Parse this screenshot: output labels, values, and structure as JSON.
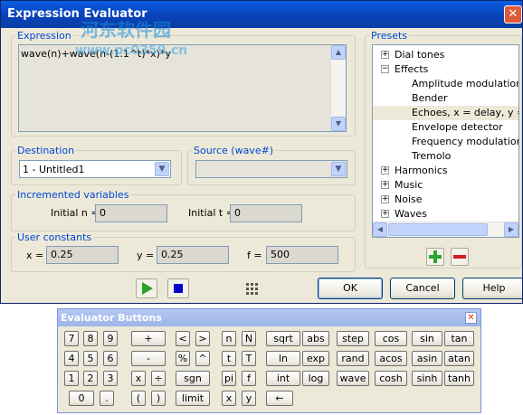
{
  "window": {
    "title": "Expression Evaluator",
    "close_glyph": "✕"
  },
  "watermark": {
    "line1": "河东软件园",
    "line2": "www.pc0359.cn"
  },
  "expression": {
    "legend": "Expression",
    "value": "wave(n)+wave(n-(1.1^t)*x)*y"
  },
  "destination": {
    "legend": "Destination",
    "selected": "1 - Untitled1"
  },
  "source": {
    "legend": "Source (wave#)",
    "selected": ""
  },
  "incremented": {
    "legend": "Incremented variables",
    "n_label": "Initial n =",
    "n_value": "0",
    "t_label": "Initial t =",
    "t_value": "0"
  },
  "constants": {
    "legend": "User constants",
    "x_label": "x =",
    "x_value": "0.25",
    "y_label": "y =",
    "y_value": "0.25",
    "f_label": "f =",
    "f_value": "500"
  },
  "presets": {
    "legend": "Presets",
    "items": [
      {
        "label": "Dial tones",
        "expander": "+"
      },
      {
        "label": "Effects",
        "expander": "−"
      },
      {
        "label": "Amplitude modulation",
        "expander": ""
      },
      {
        "label": "Bender",
        "expander": ""
      },
      {
        "label": "Echoes, x = delay, y = vo",
        "expander": ""
      },
      {
        "label": "Envelope detector",
        "expander": ""
      },
      {
        "label": "Frequency modulation",
        "expander": ""
      },
      {
        "label": "Tremolo",
        "expander": ""
      },
      {
        "label": "Harmonics",
        "expander": "+"
      },
      {
        "label": "Music",
        "expander": "+"
      },
      {
        "label": "Noise",
        "expander": "+"
      },
      {
        "label": "Waves",
        "expander": "+"
      }
    ]
  },
  "buttons": {
    "ok": "OK",
    "cancel": "Cancel",
    "help": "Help"
  },
  "colors": {
    "play": "#2ca02c",
    "stop": "#0000cc",
    "add": "#2ea52e",
    "remove": "#d02020",
    "legend": "#0046d5"
  },
  "palette": {
    "title": "Evaluator Buttons",
    "close_glyph": "✕",
    "rows": [
      [
        "7",
        "8",
        "9",
        "+",
        "<",
        ">",
        "n",
        "N",
        "sqrt",
        "abs",
        "step",
        "cos",
        "sin",
        "tan"
      ],
      [
        "4",
        "5",
        "6",
        "-",
        "%",
        "^",
        "t",
        "T",
        "ln",
        "exp",
        "rand",
        "acos",
        "asin",
        "atan"
      ],
      [
        "1",
        "2",
        "3",
        "x",
        "÷",
        "sgn",
        "pi",
        "f",
        "int",
        "log",
        "wave",
        "cosh",
        "sinh",
        "tanh"
      ],
      [
        "0",
        ".",
        "(",
        ")",
        "limit",
        "x",
        "y",
        "←"
      ]
    ]
  }
}
